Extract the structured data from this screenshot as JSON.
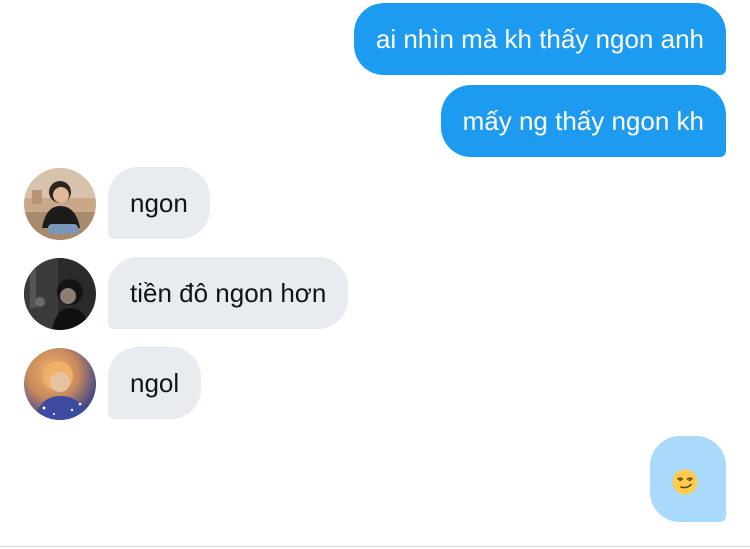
{
  "messages": [
    {
      "direction": "outgoing",
      "text": "ai nhìn mà kh thấy ngon anh"
    },
    {
      "direction": "outgoing",
      "text": "mấy ng thấy ngon kh"
    },
    {
      "direction": "incoming",
      "text": "ngon",
      "avatar": "avatar-photo-user-1"
    },
    {
      "direction": "incoming",
      "text": "tiền đô ngon hơn",
      "avatar": "avatar-photo-user-2"
    },
    {
      "direction": "incoming",
      "text": "ngol",
      "avatar": "avatar-photo-user-3"
    },
    {
      "direction": "outgoing",
      "emoji": "smirking-face-icon"
    }
  ],
  "colors": {
    "outgoing_bubble": "#1d9bf0",
    "incoming_bubble": "#e8ecf0",
    "emoji_bubble": "#a9d9fb",
    "outgoing_text": "#ffffff",
    "incoming_text": "#0f1419"
  }
}
